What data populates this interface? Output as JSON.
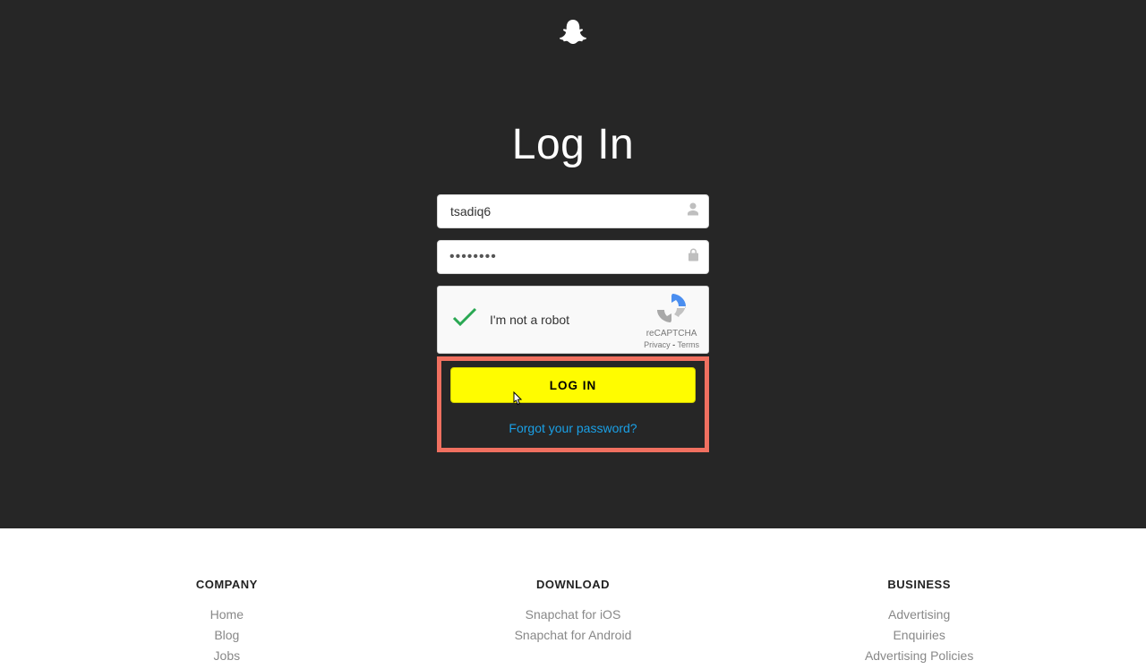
{
  "page": {
    "title": "Log In"
  },
  "form": {
    "username_value": "tsadiq6",
    "password_masked": "••••••••",
    "login_button": "LOG IN",
    "forgot_password": "Forgot your password?"
  },
  "recaptcha": {
    "label": "I'm not a robot",
    "brand": "reCAPTCHA",
    "privacy": "Privacy",
    "terms": "Terms",
    "checked": true
  },
  "footer": {
    "columns": [
      {
        "heading": "COMPANY",
        "links": [
          "Home",
          "Blog",
          "Jobs"
        ]
      },
      {
        "heading": "DOWNLOAD",
        "links": [
          "Snapchat for iOS",
          "Snapchat for Android"
        ]
      },
      {
        "heading": "BUSINESS",
        "links": [
          "Advertising",
          "Enquiries",
          "Advertising Policies"
        ]
      }
    ]
  },
  "colors": {
    "hero_bg": "#262626",
    "accent_yellow": "#fffc00",
    "highlight_red": "#f07060",
    "link_blue": "#1aa0e6"
  }
}
